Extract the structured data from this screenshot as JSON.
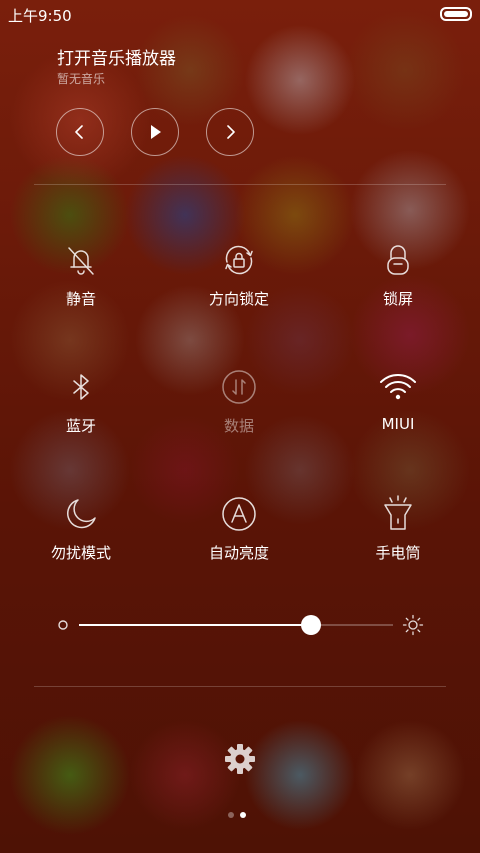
{
  "status": {
    "time": "上午9:50"
  },
  "music": {
    "title": "打开音乐播放器",
    "subtitle": "暂无音乐",
    "controls": [
      "previous",
      "play",
      "next"
    ]
  },
  "toggles": [
    {
      "label": "静音",
      "icon": "bell-off-icon",
      "active": true
    },
    {
      "label": "方向锁定",
      "icon": "rotation-lock-icon",
      "active": true
    },
    {
      "label": "锁屏",
      "icon": "lock-icon",
      "active": true
    },
    {
      "label": "蓝牙",
      "icon": "bluetooth-icon",
      "active": true
    },
    {
      "label": "数据",
      "icon": "mobile-data-icon",
      "active": false
    },
    {
      "label": "MIUI",
      "icon": "wifi-icon",
      "active": true
    },
    {
      "label": "勿扰模式",
      "icon": "moon-icon",
      "active": true
    },
    {
      "label": "自动亮度",
      "icon": "auto-brightness-icon",
      "active": true
    },
    {
      "label": "手电筒",
      "icon": "flashlight-icon",
      "active": true
    }
  ],
  "brightness": {
    "level": 0.74
  },
  "pager": {
    "count": 2,
    "current": 1
  },
  "colors": {
    "background": "#6b1a0a",
    "accent": "#ffffff"
  }
}
